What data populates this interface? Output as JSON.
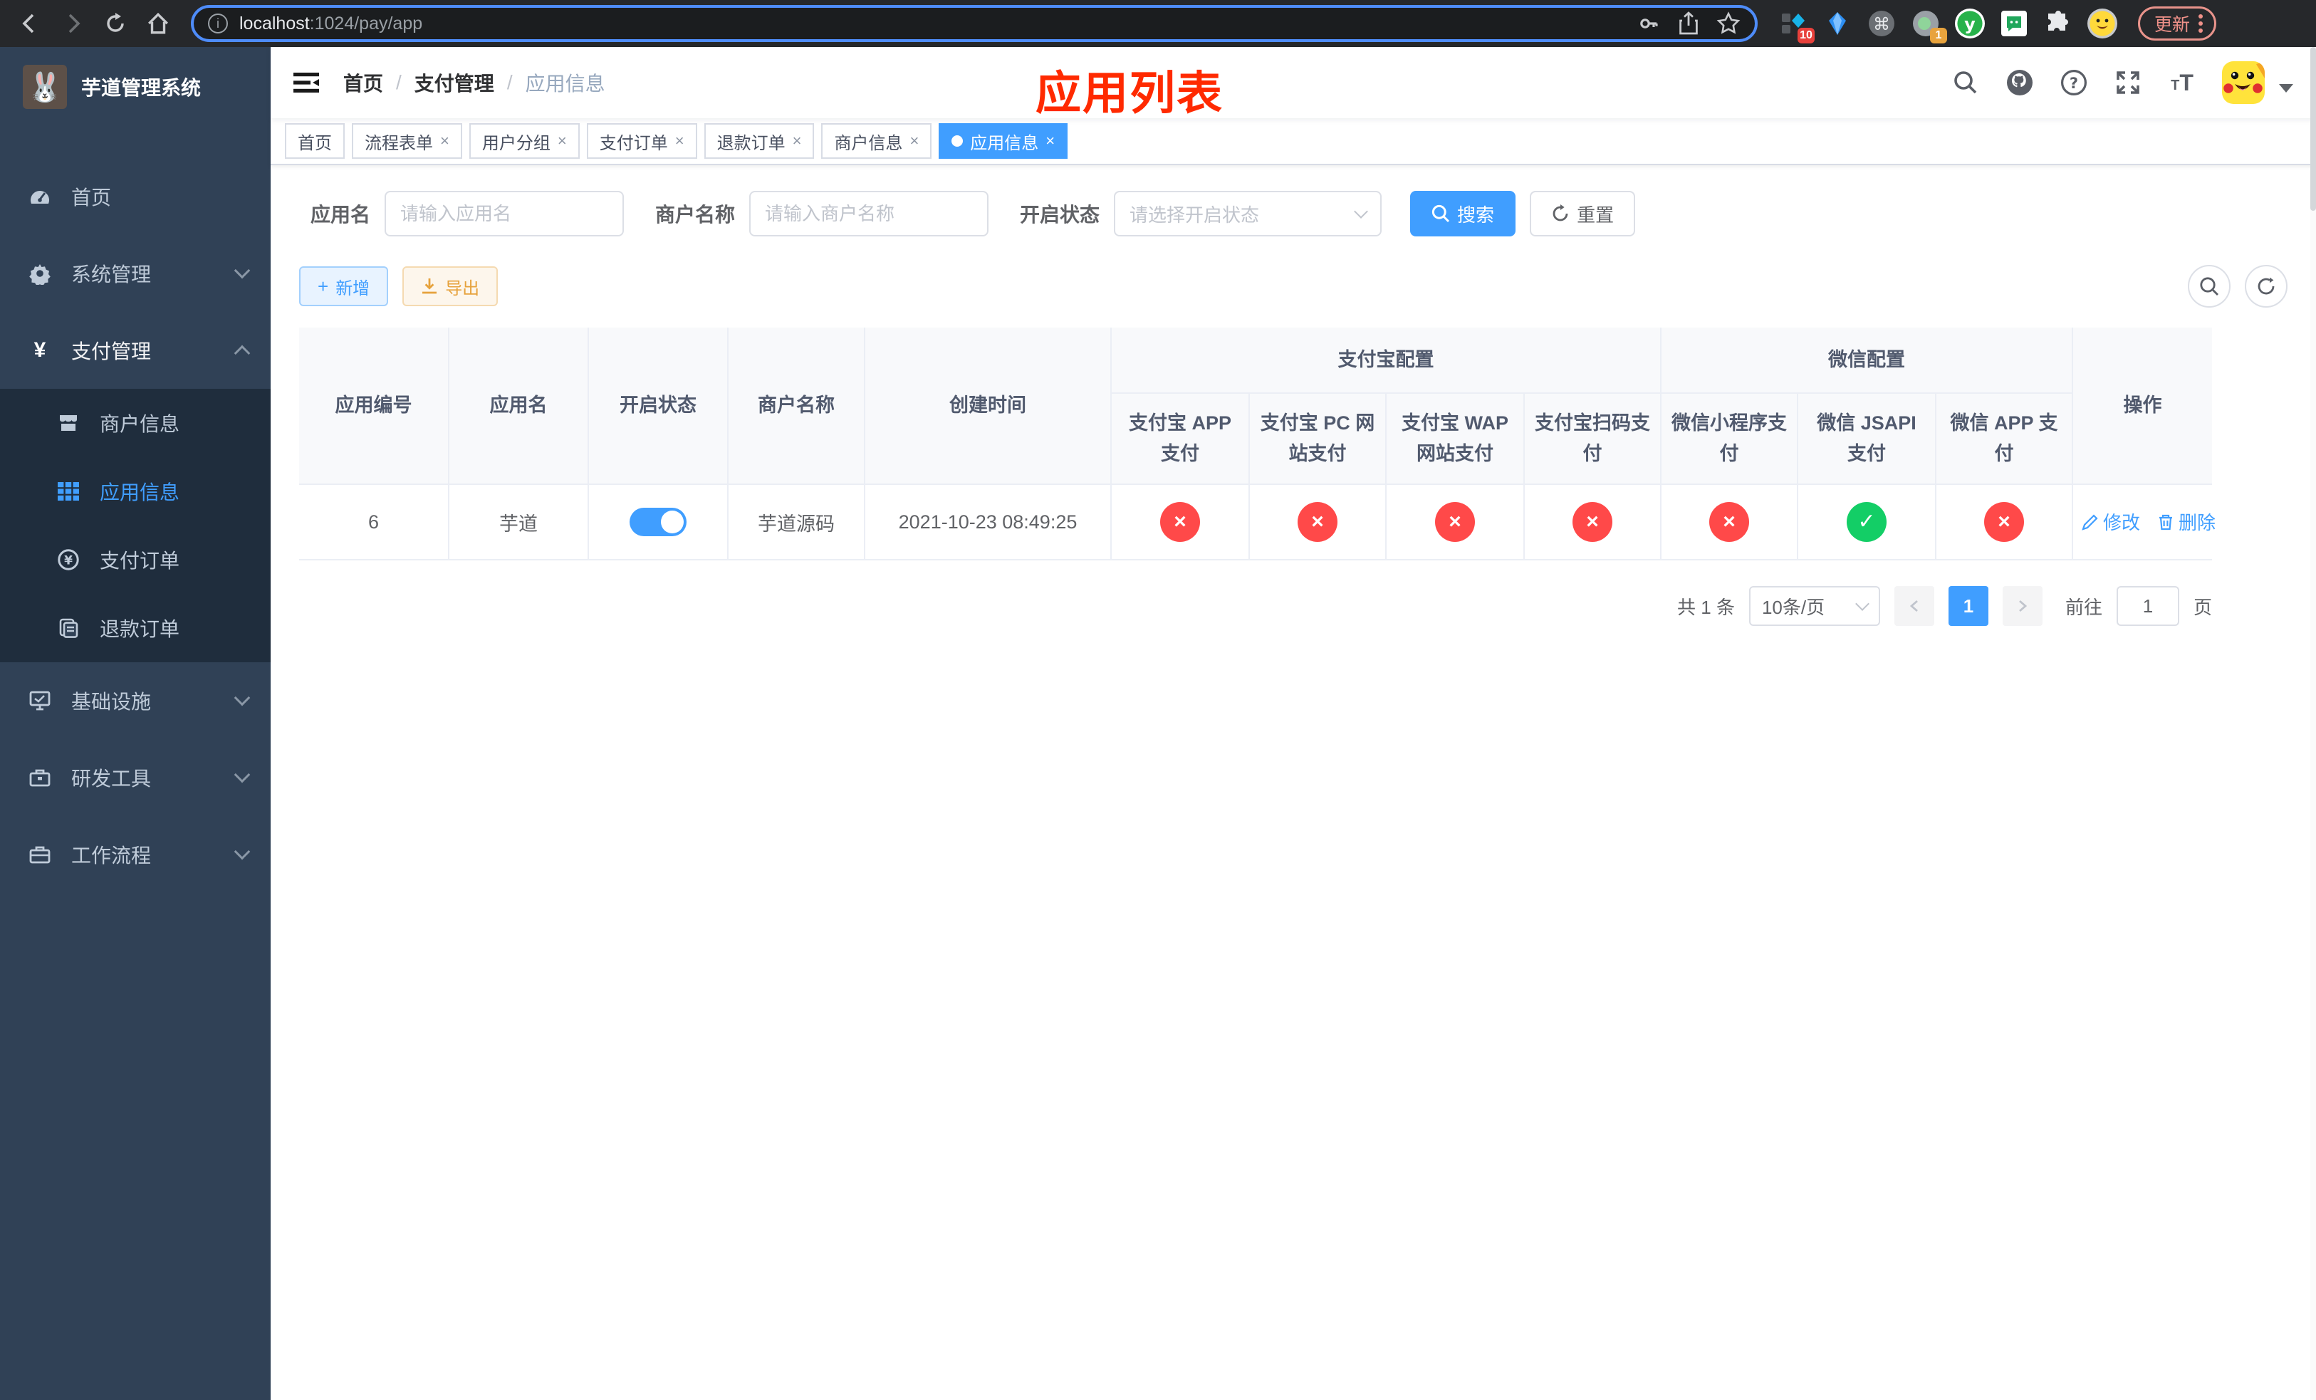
{
  "browser": {
    "url_host": "localhost",
    "url_rest": ":1024/pay/app",
    "update_label": "更新",
    "extension_badges": {
      "blocker_count": "10",
      "session_count": "1"
    },
    "icons": [
      "back-icon",
      "forward-icon",
      "reload-icon",
      "home-icon",
      "info-icon",
      "key-icon",
      "share-icon",
      "star-icon",
      "extensions-puzzle-icon",
      "menu-kebab-icon"
    ]
  },
  "sidebar": {
    "title": "芋道管理系统",
    "items": [
      {
        "label": "首页",
        "icon": "dashboard-icon"
      },
      {
        "label": "系统管理",
        "icon": "gear-icon",
        "state": "collapsed"
      },
      {
        "label": "支付管理",
        "icon": "yen-icon",
        "state": "expanded"
      },
      {
        "label": "基础设施",
        "icon": "monitor-icon",
        "state": "collapsed"
      },
      {
        "label": "研发工具",
        "icon": "toolbox-icon",
        "state": "collapsed"
      },
      {
        "label": "工作流程",
        "icon": "briefcase-icon",
        "state": "collapsed"
      }
    ],
    "pay_children": [
      {
        "label": "商户信息",
        "icon": "store-icon"
      },
      {
        "label": "应用信息",
        "icon": "grid-icon",
        "active": true
      },
      {
        "label": "支付订单",
        "icon": "coin-icon"
      },
      {
        "label": "退款订单",
        "icon": "document-icon"
      }
    ]
  },
  "header": {
    "breadcrumb": [
      "首页",
      "支付管理",
      "应用信息"
    ],
    "annotation": "应用列表"
  },
  "tabs": [
    {
      "label": "首页",
      "closable": false,
      "active": false
    },
    {
      "label": "流程表单",
      "closable": true,
      "active": false
    },
    {
      "label": "用户分组",
      "closable": true,
      "active": false
    },
    {
      "label": "支付订单",
      "closable": true,
      "active": false
    },
    {
      "label": "退款订单",
      "closable": true,
      "active": false
    },
    {
      "label": "商户信息",
      "closable": true,
      "active": false
    },
    {
      "label": "应用信息",
      "closable": true,
      "active": true
    }
  ],
  "filters": {
    "app_name_label": "应用名",
    "app_name_placeholder": "请输入应用名",
    "merchant_label": "商户名称",
    "merchant_placeholder": "请输入商户名称",
    "status_label": "开启状态",
    "status_placeholder": "请选择开启状态",
    "search_label": "搜索",
    "reset_label": "重置"
  },
  "toolbar": {
    "add_label": "新增",
    "export_label": "导出"
  },
  "table": {
    "columns": [
      "应用编号",
      "应用名",
      "开启状态",
      "商户名称",
      "创建时间",
      "操作"
    ],
    "group_headers": {
      "alipay": "支付宝配置",
      "wechat": "微信配置"
    },
    "sub_columns": [
      "支付宝 APP 支付",
      "支付宝 PC 网站支付",
      "支付宝 WAP 网站支付",
      "支付宝扫码支付",
      "微信小程序支付",
      "微信 JSAPI 支付",
      "微信 APP 支付"
    ],
    "rows": [
      {
        "id": "6",
        "app_name": "芋道",
        "enabled": true,
        "merchant": "芋道源码",
        "created_at": "2021-10-23 08:49:25",
        "pay_statuses": [
          "x",
          "x",
          "x",
          "x",
          "x",
          "check",
          "x"
        ],
        "edit_label": "修改",
        "delete_label": "删除"
      }
    ]
  },
  "pagination": {
    "total_text": "共 1 条",
    "page_size_text": "10条/页",
    "current_page": "1",
    "goto_label": "前往",
    "goto_value": "1",
    "goto_suffix": "页"
  },
  "colors": {
    "primary": "#409eff",
    "success": "#13ce66",
    "danger": "#ff4949",
    "warning": "#e6a23c",
    "sidebar_bg": "#304156",
    "submenu_bg": "#1f2d3d",
    "annotation_red": "#ff2a00"
  }
}
